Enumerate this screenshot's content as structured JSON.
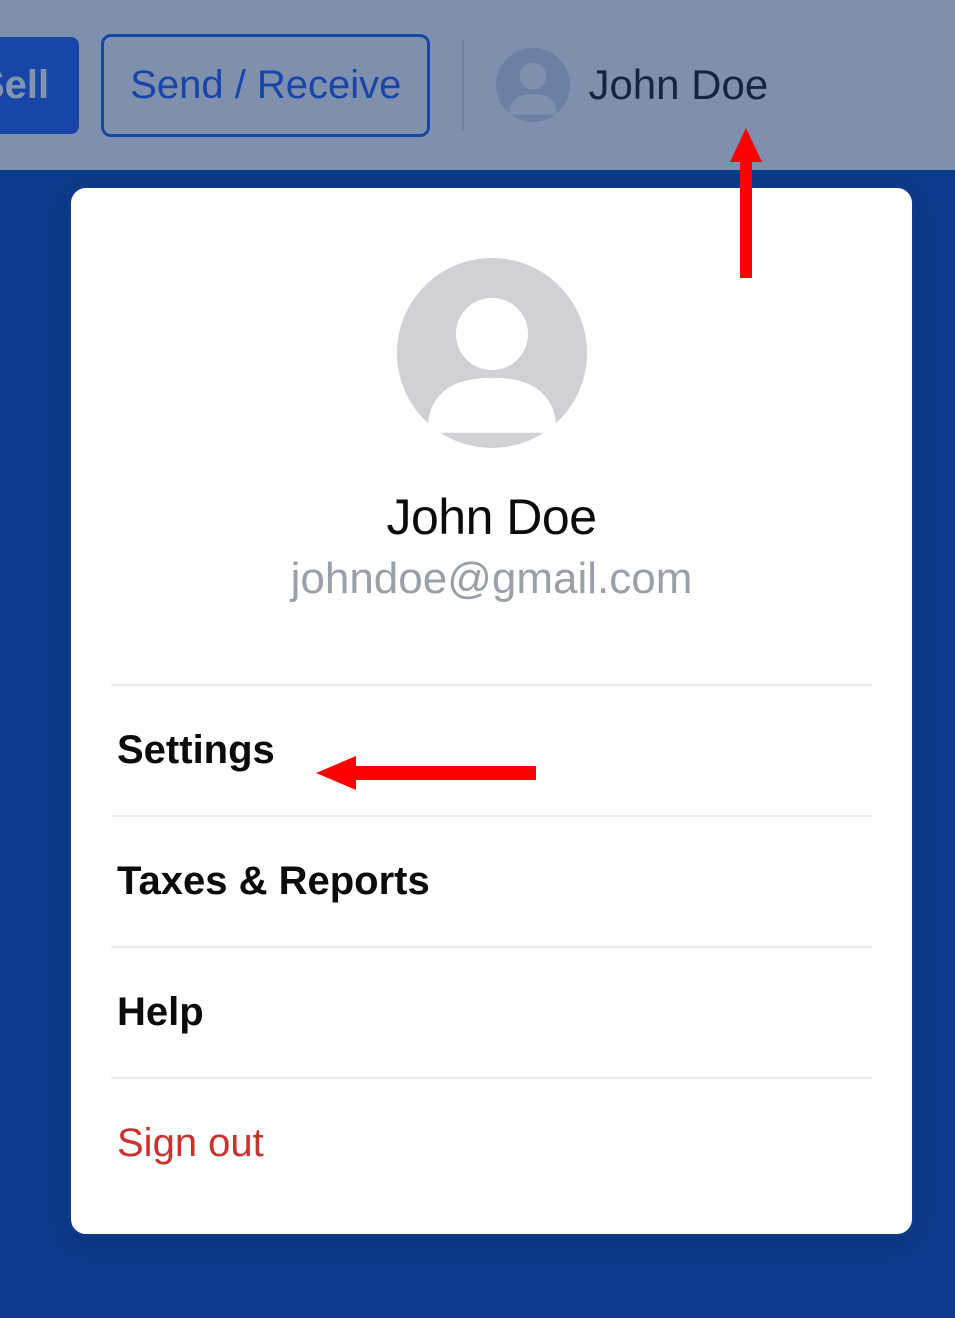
{
  "header": {
    "sell_label": "Sell",
    "send_receive_label": "Send / Receive",
    "profile_name": "John Doe"
  },
  "profile": {
    "name": "John Doe",
    "email": "johndoe@gmail.com"
  },
  "menu": {
    "settings": "Settings",
    "taxes": "Taxes & Reports",
    "help": "Help",
    "signout": "Sign out"
  }
}
